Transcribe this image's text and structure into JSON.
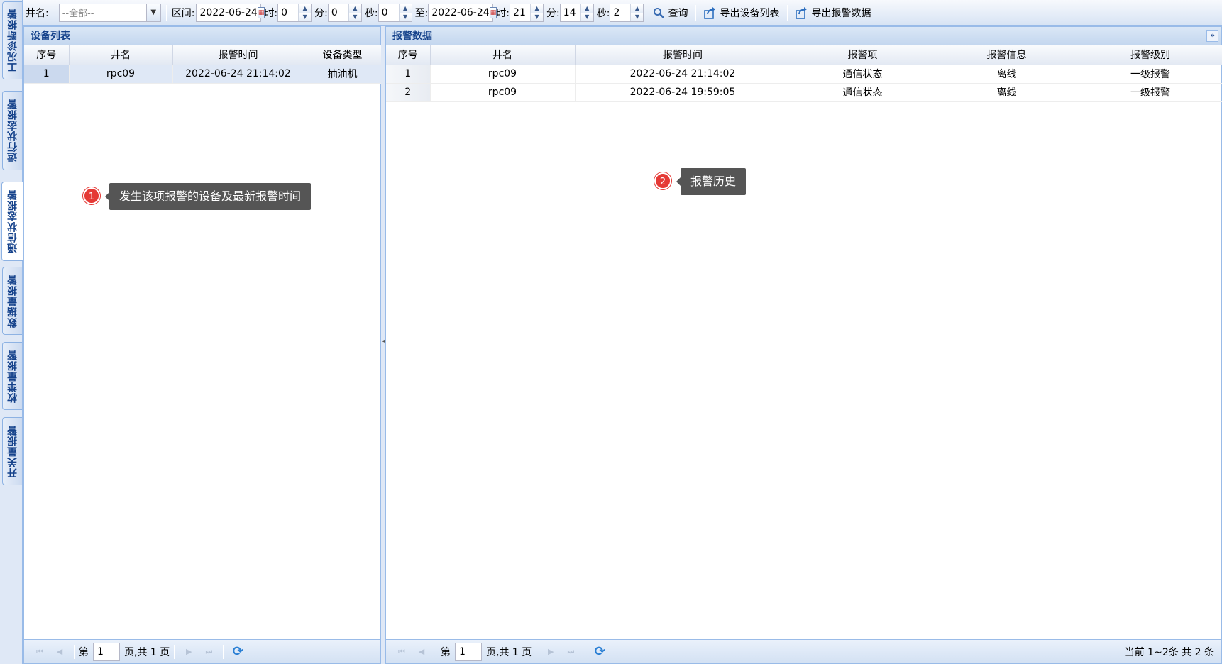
{
  "vertical_tabs": [
    {
      "label": "工况诊断报警",
      "active": false
    },
    {
      "label": "运行状态报警",
      "active": false
    },
    {
      "label": "通信状态报警",
      "active": true
    },
    {
      "label": "数据量报警",
      "active": false
    },
    {
      "label": "枚举量报警",
      "active": false
    },
    {
      "label": "开关量报警",
      "active": false
    }
  ],
  "toolbar": {
    "well_label": "井名:",
    "well_value": "--全部--",
    "range_label": "区间:",
    "start_date": "2022-06-24",
    "hour_label": "时:",
    "start_hour": "0",
    "minute_label": "分:",
    "start_minute": "0",
    "second_label": "秒:",
    "start_second": "0",
    "to_label": "至:",
    "end_date": "2022-06-24",
    "end_hour": "21",
    "end_minute": "14",
    "end_second": "2",
    "query_label": "查询",
    "export_device_label": "导出设备列表",
    "export_alarm_label": "导出报警数据"
  },
  "device_panel": {
    "title": "设备列表",
    "columns": [
      "序号",
      "井名",
      "报警时间",
      "设备类型"
    ],
    "rows": [
      {
        "index": "1",
        "well": "rpc09",
        "time": "2022-06-24 21:14:02",
        "type": "抽油机"
      }
    ],
    "pager": {
      "page_prefix": "第",
      "page": "1",
      "page_suffix": "页,共 1 页"
    }
  },
  "alarm_panel": {
    "title": "报警数据",
    "collapse_icon": "double-chevron-right-icon",
    "columns": [
      "序号",
      "井名",
      "报警时间",
      "报警项",
      "报警信息",
      "报警级别"
    ],
    "rows": [
      {
        "index": "1",
        "well": "rpc09",
        "time": "2022-06-24 21:14:02",
        "item": "通信状态",
        "info": "离线",
        "level": "一级报警"
      },
      {
        "index": "2",
        "well": "rpc09",
        "time": "2022-06-24 19:59:05",
        "item": "通信状态",
        "info": "离线",
        "level": "一级报警"
      }
    ],
    "pager": {
      "page_prefix": "第",
      "page": "1",
      "page_suffix": "页,共 1 页",
      "summary": "当前 1~2条 共 2 条"
    }
  },
  "annotations": [
    {
      "number": "1",
      "text": "发生该项报警的设备及最新报警时间"
    },
    {
      "number": "2",
      "text": "报警历史"
    }
  ]
}
